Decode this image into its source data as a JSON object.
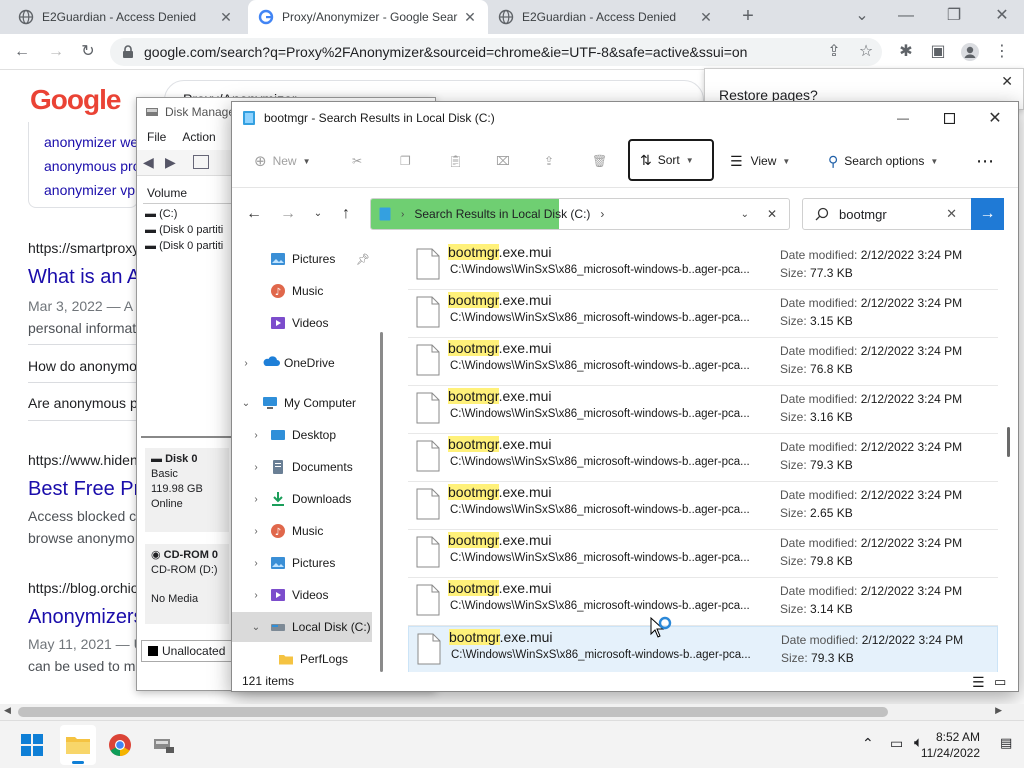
{
  "browser": {
    "tabs": [
      {
        "title": "E2Guardian - Access Denied"
      },
      {
        "title": "Proxy/Anonymizer - Google Sear"
      },
      {
        "title": "E2Guardian - Access Denied"
      }
    ],
    "url": "google.com/search?q=Proxy%2FAnonymizer&sourceid=chrome&ie=UTF-8&safe=active&ssui=on"
  },
  "google": {
    "logo": "Google",
    "query": "Proxy/Anonymizer",
    "suggestions": [
      "anonymizer we",
      "anonymous pro",
      "anonymizer vp"
    ],
    "results": [
      {
        "url": "https://smartproxy",
        "title": "What is an A",
        "snippet1": "Mar 3, 2022 — A",
        "snippet2": "personal informat"
      },
      {
        "q1": "How do anonymo",
        "q2": "Are anonymous p"
      },
      {
        "url": "https://www.hiden",
        "title": "Best Free Pr",
        "snippet1": "Access blocked c",
        "snippet2": "browse anonymo"
      },
      {
        "url": "https://blog.orchio",
        "title": "Anonymizers",
        "snippet1": "May 11, 2021 — U",
        "snippet2": "can be used to m"
      }
    ],
    "restore_text": "Restore pages?"
  },
  "disk_mgmt": {
    "title": "Disk Manage",
    "menu": [
      "File",
      "Action"
    ],
    "col_volume": "Volume",
    "volumes": [
      "(C:)",
      "(Disk 0 partiti",
      "(Disk 0 partiti"
    ],
    "disk0": {
      "name": "Disk 0",
      "type": "Basic",
      "size": "119.98 GB",
      "status": "Online"
    },
    "cdrom": {
      "name": "CD-ROM 0",
      "type": "CD-ROM (D:)",
      "media": "No Media"
    },
    "legend": "Unallocated"
  },
  "explorer": {
    "title": "bootmgr - Search Results in Local Disk (C:)",
    "cmd": {
      "new": "New",
      "sort": "Sort",
      "view": "View",
      "search_options": "Search options"
    },
    "address": "Search Results in Local Disk (C:)",
    "search_value": "bootmgr",
    "sidebar": [
      {
        "label": "Pictures",
        "icon": "pictures-icon",
        "pinned": true
      },
      {
        "label": "Music",
        "icon": "music-icon"
      },
      {
        "label": "Videos",
        "icon": "videos-icon"
      },
      {
        "label": "OneDrive",
        "icon": "onedrive-icon"
      },
      {
        "label": "My Computer",
        "icon": "computer-icon"
      },
      {
        "label": "Desktop",
        "icon": "desktop-icon"
      },
      {
        "label": "Documents",
        "icon": "documents-icon"
      },
      {
        "label": "Downloads",
        "icon": "downloads-icon"
      },
      {
        "label": "Music",
        "icon": "music-icon"
      },
      {
        "label": "Pictures",
        "icon": "pictures-icon"
      },
      {
        "label": "Videos",
        "icon": "videos-icon"
      },
      {
        "label": "Local Disk (C:)",
        "icon": "drive-icon"
      },
      {
        "label": "PerfLogs",
        "icon": "folder-icon"
      }
    ],
    "results": [
      {
        "hl": "bootmgr",
        "rest": ".exe.mui",
        "path": "C:\\Windows\\WinSxS\\x86_microsoft-windows-b..ager-pca...",
        "date": "2/12/2022 3:24 PM",
        "size": "77.3 KB"
      },
      {
        "hl": "bootmgr",
        "rest": ".exe.mui",
        "path": "C:\\Windows\\WinSxS\\x86_microsoft-windows-b..ager-pca...",
        "date": "2/12/2022 3:24 PM",
        "size": "3.15 KB"
      },
      {
        "hl": "bootmgr",
        "rest": ".exe.mui",
        "path": "C:\\Windows\\WinSxS\\x86_microsoft-windows-b..ager-pca...",
        "date": "2/12/2022 3:24 PM",
        "size": "76.8 KB"
      },
      {
        "hl": "bootmgr",
        "rest": ".exe.mui",
        "path": "C:\\Windows\\WinSxS\\x86_microsoft-windows-b..ager-pca...",
        "date": "2/12/2022 3:24 PM",
        "size": "3.16 KB"
      },
      {
        "hl": "bootmgr",
        "rest": ".exe.mui",
        "path": "C:\\Windows\\WinSxS\\x86_microsoft-windows-b..ager-pca...",
        "date": "2/12/2022 3:24 PM",
        "size": "79.3 KB"
      },
      {
        "hl": "bootmgr",
        "rest": ".exe.mui",
        "path": "C:\\Windows\\WinSxS\\x86_microsoft-windows-b..ager-pca...",
        "date": "2/12/2022 3:24 PM",
        "size": "2.65 KB"
      },
      {
        "hl": "bootmgr",
        "rest": ".exe.mui",
        "path": "C:\\Windows\\WinSxS\\x86_microsoft-windows-b..ager-pca...",
        "date": "2/12/2022 3:24 PM",
        "size": "79.8 KB"
      },
      {
        "hl": "bootmgr",
        "rest": ".exe.mui",
        "path": "C:\\Windows\\WinSxS\\x86_microsoft-windows-b..ager-pca...",
        "date": "2/12/2022 3:24 PM",
        "size": "3.14 KB"
      },
      {
        "hl": "bootmgr",
        "rest": ".exe.mui",
        "path": "C:\\Windows\\WinSxS\\x86_microsoft-windows-b..ager-pca...",
        "date": "2/12/2022 3:24 PM",
        "size": "79.3 KB"
      }
    ],
    "date_label": "Date modified:",
    "size_label": "Size:",
    "status": "121 items"
  },
  "taskbar": {
    "time": "8:52 AM",
    "date": "11/24/2022"
  },
  "colors": {
    "accent": "#1f7ad6",
    "highlight": "#fff17a",
    "address_progress": "#6fcf72"
  }
}
